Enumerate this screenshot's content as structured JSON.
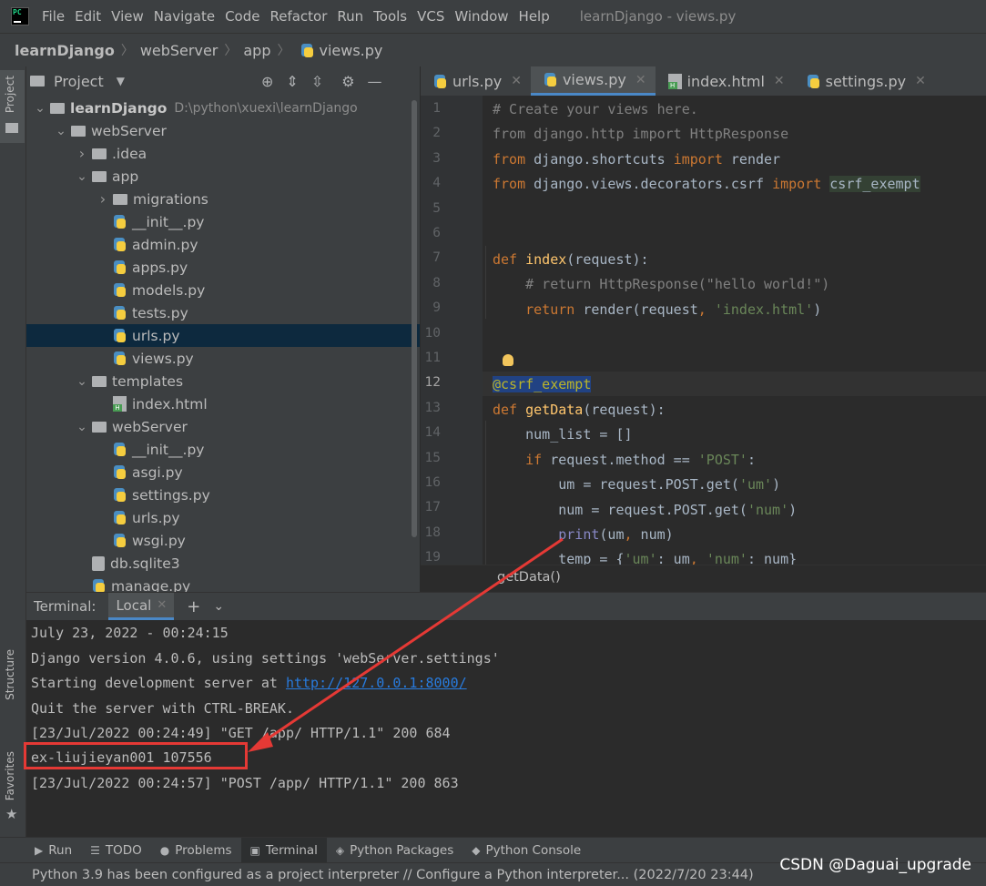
{
  "menu": {
    "items": [
      "File",
      "Edit",
      "View",
      "Navigate",
      "Code",
      "Refactor",
      "Run",
      "Tools",
      "VCS",
      "Window",
      "Help"
    ],
    "window_title": "learnDjango - views.py"
  },
  "nav": {
    "crumbs": [
      "learnDjango",
      "webServer",
      "app",
      "views.py"
    ]
  },
  "sidebar_tabs": {
    "project": "Project",
    "structure": "Structure",
    "favorites": "Favorites"
  },
  "project_panel": {
    "title": "Project",
    "tree": [
      {
        "label": "learnDjango",
        "hint": "D:\\python\\xuexi\\learnDjango",
        "depth": 0,
        "type": "folder",
        "expanded": true,
        "bold": true
      },
      {
        "label": "webServer",
        "depth": 1,
        "type": "folder",
        "expanded": true
      },
      {
        "label": ".idea",
        "depth": 2,
        "type": "folder",
        "expanded": false
      },
      {
        "label": "app",
        "depth": 2,
        "type": "folder",
        "expanded": true
      },
      {
        "label": "migrations",
        "depth": 3,
        "type": "folder",
        "expanded": false
      },
      {
        "label": "__init__.py",
        "depth": 3,
        "type": "py"
      },
      {
        "label": "admin.py",
        "depth": 3,
        "type": "py"
      },
      {
        "label": "apps.py",
        "depth": 3,
        "type": "py"
      },
      {
        "label": "models.py",
        "depth": 3,
        "type": "py"
      },
      {
        "label": "tests.py",
        "depth": 3,
        "type": "py"
      },
      {
        "label": "urls.py",
        "depth": 3,
        "type": "py",
        "selected": true
      },
      {
        "label": "views.py",
        "depth": 3,
        "type": "py"
      },
      {
        "label": "templates",
        "depth": 2,
        "type": "folder",
        "expanded": true
      },
      {
        "label": "index.html",
        "depth": 3,
        "type": "html"
      },
      {
        "label": "webServer",
        "depth": 2,
        "type": "folder",
        "expanded": true
      },
      {
        "label": "__init__.py",
        "depth": 3,
        "type": "py"
      },
      {
        "label": "asgi.py",
        "depth": 3,
        "type": "py"
      },
      {
        "label": "settings.py",
        "depth": 3,
        "type": "py"
      },
      {
        "label": "urls.py",
        "depth": 3,
        "type": "py"
      },
      {
        "label": "wsgi.py",
        "depth": 3,
        "type": "py"
      },
      {
        "label": "db.sqlite3",
        "depth": 2,
        "type": "db"
      },
      {
        "label": "manage.py",
        "depth": 2,
        "type": "py"
      }
    ]
  },
  "editor": {
    "tabs": [
      {
        "label": "urls.py",
        "icon": "py"
      },
      {
        "label": "views.py",
        "icon": "py",
        "active": true
      },
      {
        "label": "index.html",
        "icon": "html"
      },
      {
        "label": "settings.py",
        "icon": "py"
      }
    ],
    "line_numbers": [
      "1",
      "2",
      "3",
      "4",
      "5",
      "6",
      "7",
      "8",
      "9",
      "10",
      "11",
      "12",
      "13",
      "14",
      "15",
      "16",
      "17",
      "18",
      "19"
    ],
    "current_line": "12",
    "breadcrumb": "getData()"
  },
  "terminal": {
    "label": "Terminal:",
    "tab": "Local",
    "lines": {
      "l1": "July 23, 2022 - 00:24:15",
      "l2": "Django version 4.0.6, using settings 'webServer.settings'",
      "l3_prefix": "Starting development server at ",
      "l3_link": "http://127.0.0.1:8000/",
      "l4": "Quit the server with CTRL-BREAK.",
      "l5": "[23/Jul/2022 00:24:49] \"GET /app/ HTTP/1.1\" 200 684",
      "l6": "ex-liujieyan001 107556",
      "l7": "[23/Jul/2022 00:24:57] \"POST /app/ HTTP/1.1\" 200 863"
    }
  },
  "tool_windows": [
    "Run",
    "TODO",
    "Problems",
    "Terminal",
    "Python Packages",
    "Python Console"
  ],
  "status": "Python 3.9 has been configured as a project interpreter // Configure a Python interpreter... (2022/7/20 23:44)",
  "watermark": "CSDN @Daguai_upgrade",
  "colors": {
    "keyword": "#cc7832",
    "function": "#ffc66d",
    "string": "#6a8759",
    "comment": "#808080",
    "decorator": "#bbb529",
    "annotation_red": "#e53935",
    "link": "#287bde"
  }
}
